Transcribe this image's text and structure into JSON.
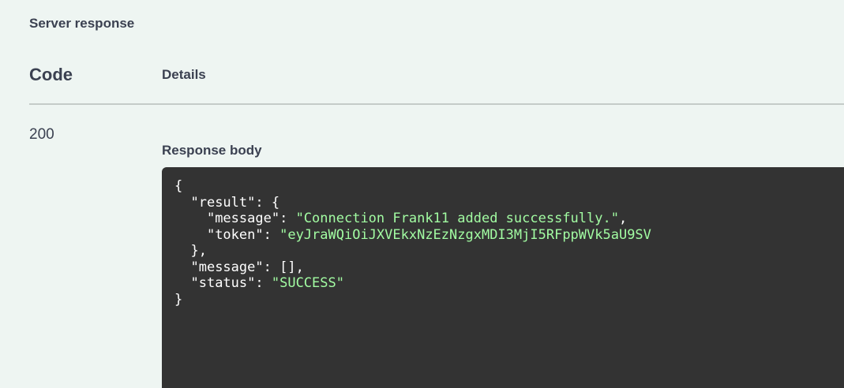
{
  "section_title": "Server response",
  "columns": {
    "code": "Code",
    "details": "Details"
  },
  "response": {
    "status_code": "200",
    "body_label": "Response body",
    "json": {
      "open_brace": "{",
      "result_key": "\"result\"",
      "message_key": "\"message\"",
      "message_value": "\"Connection Frank11 added successfully.\"",
      "token_key": "\"token\"",
      "token_value": "\"eyJraWQiOiJXVEkxNzEzNzgxMDI3MjI5RFppWVk5aU9SV",
      "result_close": "},",
      "outer_message_key": "\"message\"",
      "outer_message_value": "[]",
      "status_key": "\"status\"",
      "status_value": "\"SUCCESS\"",
      "close_brace": "}"
    }
  }
}
